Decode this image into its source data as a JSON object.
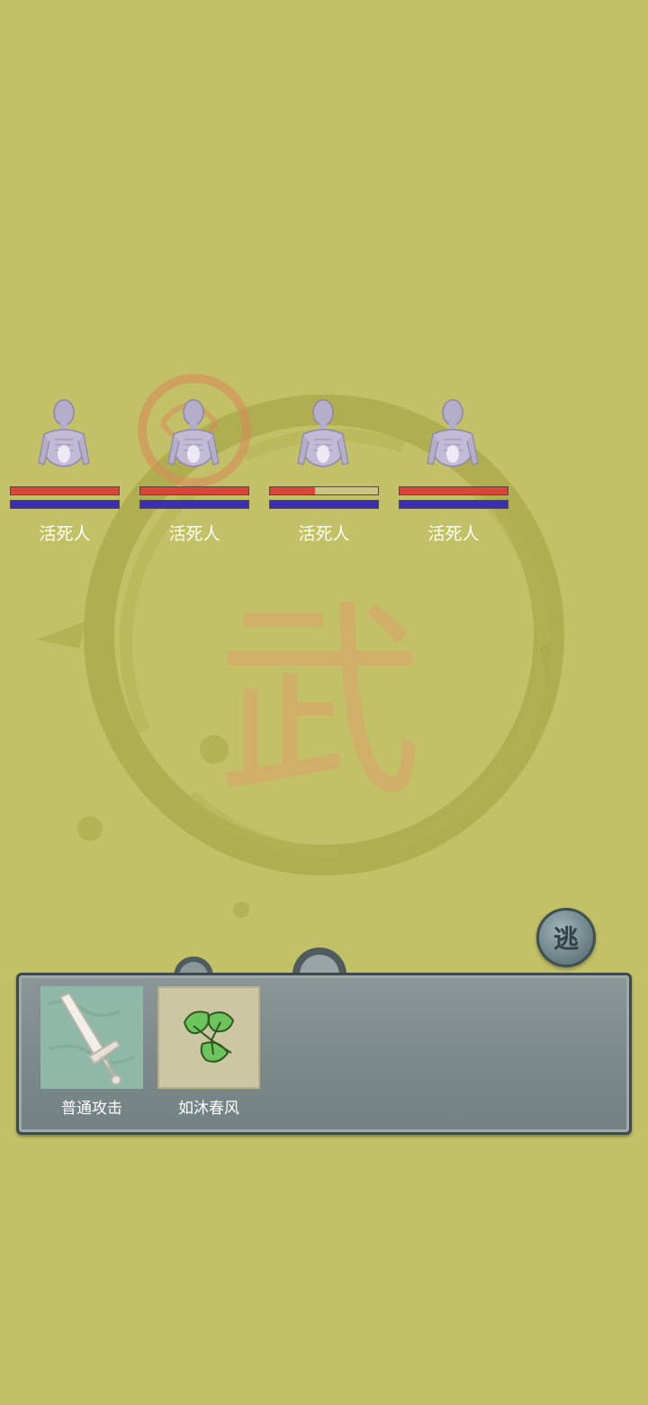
{
  "enemies": [
    {
      "name": "活死人",
      "hp": 1.0,
      "mp": 1.0
    },
    {
      "name": "活死人",
      "hp": 1.0,
      "mp": 1.0
    },
    {
      "name": "活死人",
      "hp": 0.42,
      "mp": 1.0
    },
    {
      "name": "活死人",
      "hp": 1.0,
      "mp": 1.0
    }
  ],
  "flee_button": {
    "label": "逃",
    "icon": "flee-seal-icon"
  },
  "skills": [
    {
      "label": "普通攻击",
      "icon": "sword-icon"
    },
    {
      "label": "如沐春风",
      "icon": "leaf-icon"
    }
  ],
  "background": {
    "center_glyph": "武",
    "icon": "ink-circle-emblem"
  },
  "colors": {
    "background": "#c3c167",
    "hp": "#d9453b",
    "mp": "#3a2fb0",
    "panel": "#7d8a8c"
  }
}
